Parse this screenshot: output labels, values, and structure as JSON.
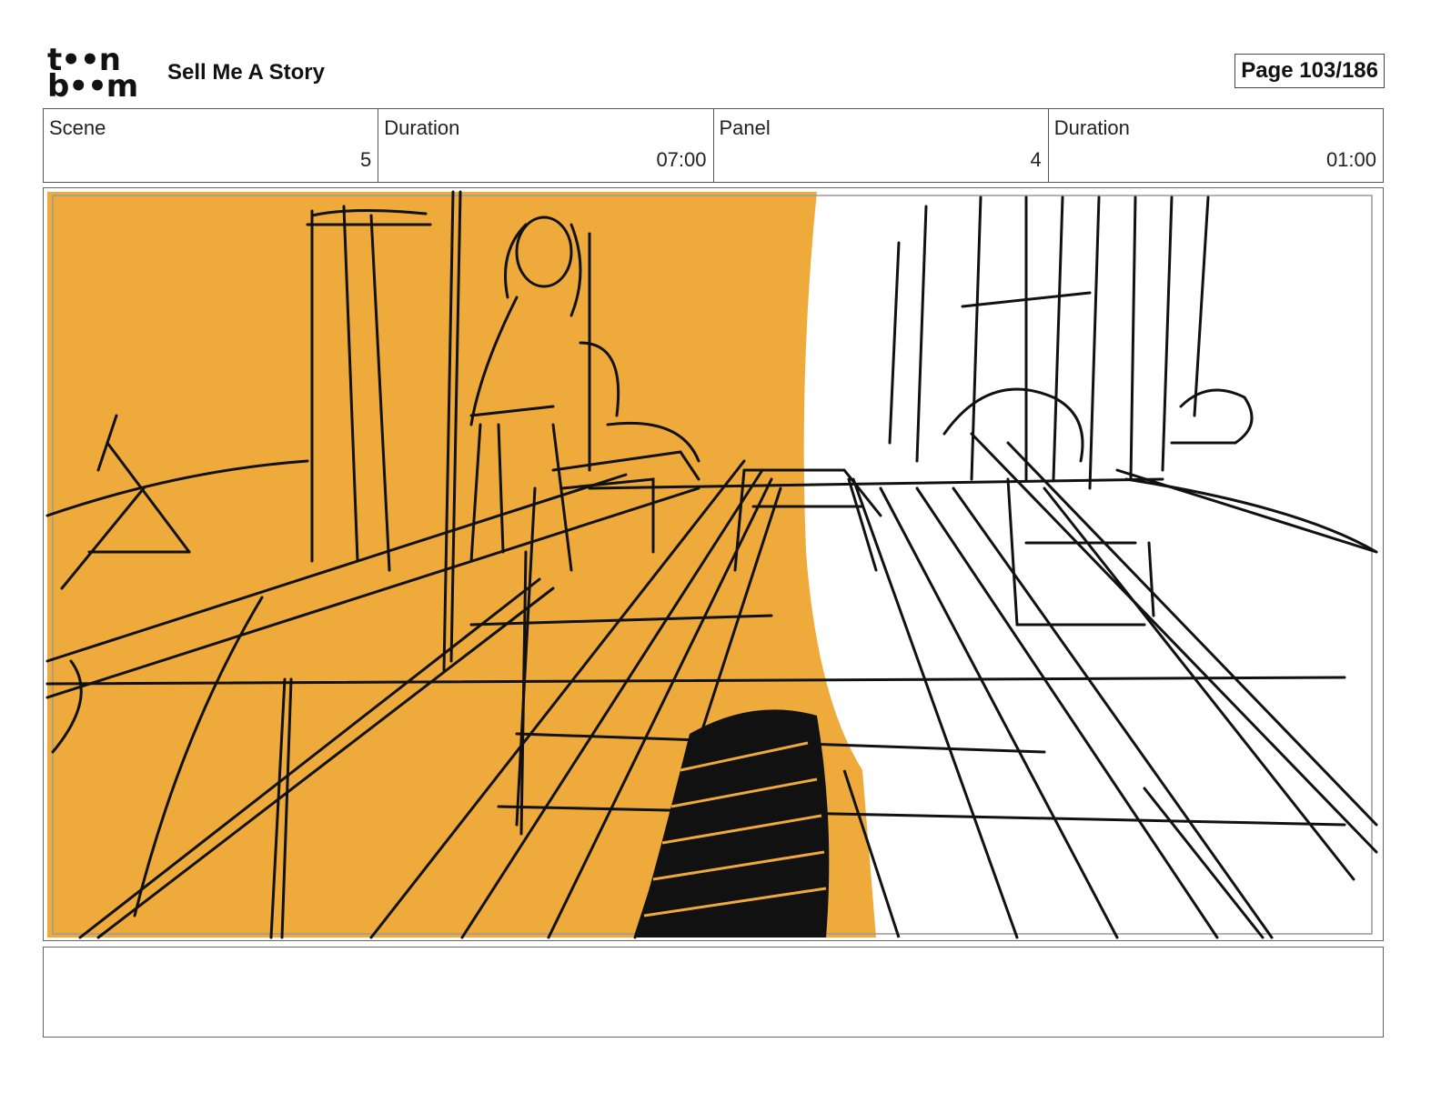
{
  "header": {
    "logo_line1": "t••n",
    "logo_line2": "b••m",
    "project_title": "Sell Me A Story",
    "page_label": "Page 103/186"
  },
  "info": {
    "scene_label": "Scene",
    "scene_value": "5",
    "scene_duration_label": "Duration",
    "scene_duration_value": "07:00",
    "panel_label": "Panel",
    "panel_value": "4",
    "panel_duration_label": "Duration",
    "panel_duration_value": "01:00"
  },
  "colors": {
    "fill": "#EEAA3B",
    "ink": "#111111"
  },
  "notes": {
    "text": ""
  }
}
